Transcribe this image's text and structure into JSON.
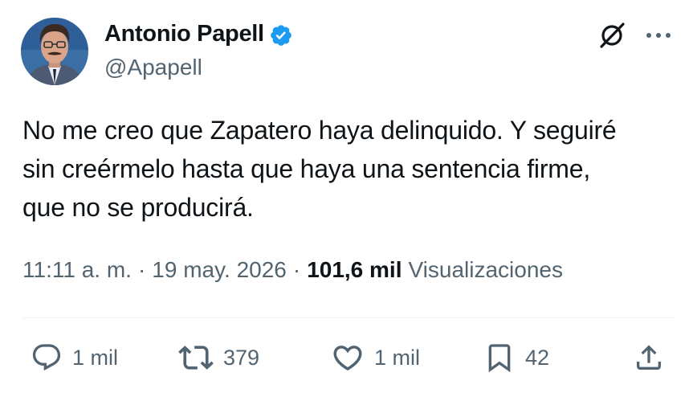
{
  "author": {
    "display_name": "Antonio Papell",
    "handle": "@Apapell",
    "verified": true,
    "verified_color": "#1d9bf0"
  },
  "tweet": {
    "text": "No me creo que Zapatero haya delinquido. Y seguiré sin creérmelo hasta que haya una sentencia firme, que no se producirá."
  },
  "meta": {
    "time": "11:11 a. m.",
    "separator": "·",
    "date": "19 may. 2026",
    "views_count": "101,6 mil",
    "views_label": "Visualizaciones"
  },
  "actions": {
    "replies": "1 mil",
    "retweets": "379",
    "likes": "1 mil",
    "bookmarks": "42"
  },
  "icons": {
    "header": [
      "grok-icon",
      "more-icon"
    ],
    "actions": [
      "reply-icon",
      "retweet-icon",
      "like-icon",
      "bookmark-icon",
      "share-icon"
    ]
  },
  "colors": {
    "text": "#0f1419",
    "secondary": "#536471",
    "divider": "#eff3f4",
    "background": "#ffffff"
  }
}
